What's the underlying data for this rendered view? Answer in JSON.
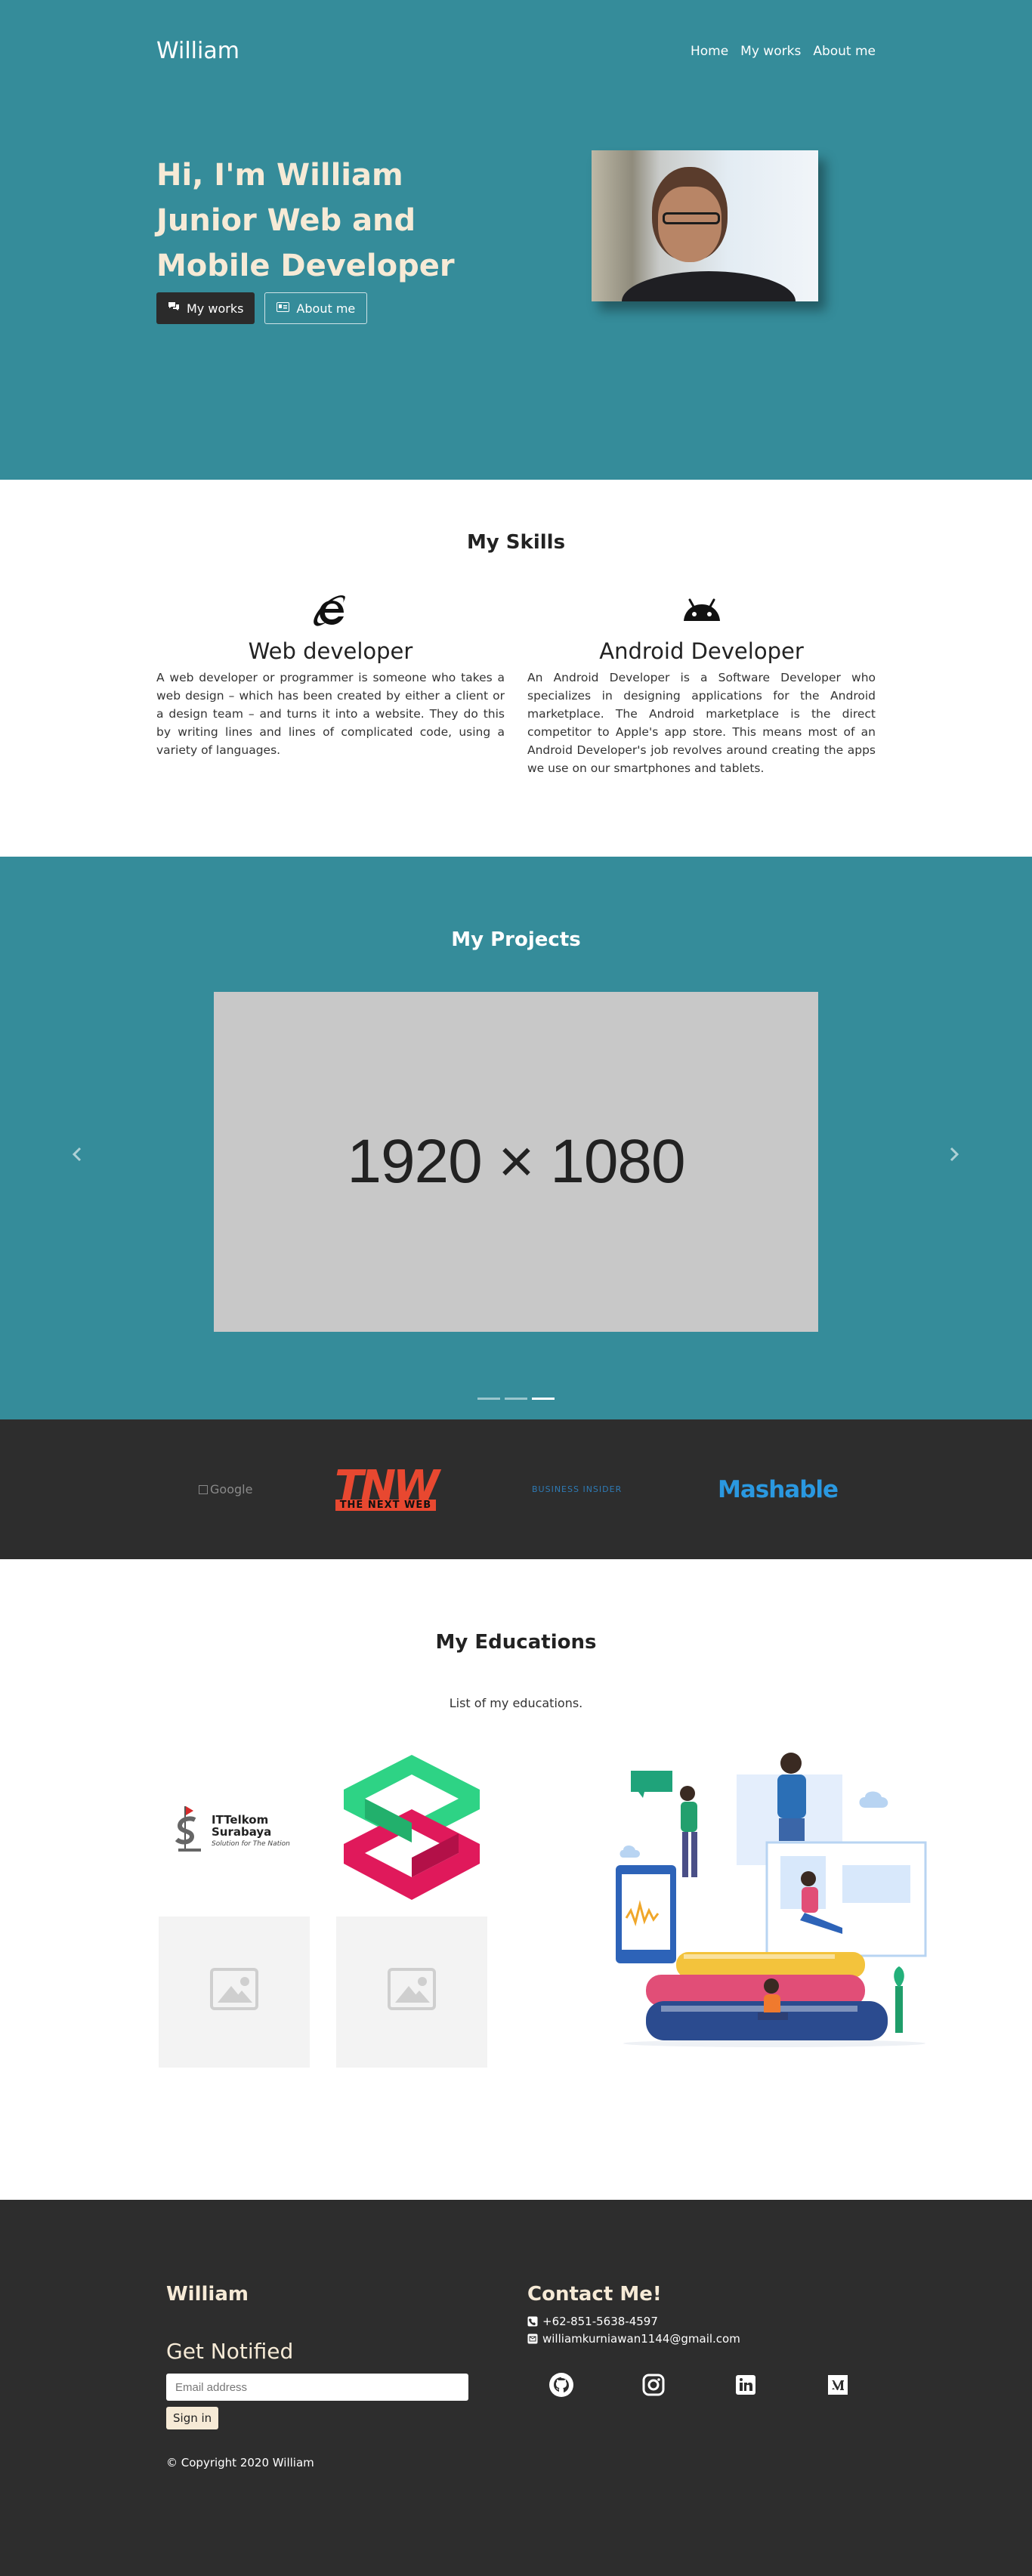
{
  "nav": {
    "brand": "William",
    "links": [
      "Home",
      "My works",
      "About me"
    ]
  },
  "hero": {
    "title_lines": [
      "Hi, I'm William",
      "Junior Web and",
      "Mobile Developer"
    ],
    "btn_works": "My works",
    "btn_about": "About me"
  },
  "skills": {
    "title": "My Skills",
    "items": [
      {
        "icon": "internet-explorer-icon",
        "title": "Web developer",
        "text": "A web developer or programmer is someone who takes a web design – which has been created by either a client or a design team – and turns it into a website. They do this by writing lines and lines of complicated code, using a variety of languages."
      },
      {
        "icon": "android-icon",
        "title": "Android Developer",
        "text": "An Android Developer is a Software Developer who specializes in designing applications for the Android marketplace. The Android marketplace is the direct competitor to Apple's app store. This means most of an Android Developer's job revolves around creating the apps we use on our smartphones and tablets."
      }
    ]
  },
  "projects": {
    "title": "My Projects",
    "slide_text": "1920 × 1080",
    "indicator_count": 3,
    "active_index": 2
  },
  "logos": {
    "google_alt": "Google",
    "tnw_big": "TNW",
    "tnw_small": "THE NEXT WEB",
    "business_insider": "BUSINESS INSIDER",
    "mashable": "Mashable"
  },
  "educations": {
    "title": "My Educations",
    "subtitle": "List of my educations.",
    "itt_name_1": "ITTelkom",
    "itt_name_2": "Surabaya",
    "itt_tagline": "Solution for The Nation"
  },
  "footer": {
    "brand": "William",
    "notify_title": "Get Notified",
    "email_placeholder": "Email address",
    "signin_label": "Sign in",
    "copyright": "© Copyright 2020 William",
    "contact_title": "Contact Me!",
    "phone": "+62-851-5638-4597",
    "email": "williamkurniawan1144@gmail.com",
    "social": [
      "github-icon",
      "instagram-icon",
      "linkedin-icon",
      "medium-icon"
    ]
  },
  "colors": {
    "teal": "#358c9a",
    "dark": "#2d2d2d",
    "cream": "#f6ead6"
  }
}
